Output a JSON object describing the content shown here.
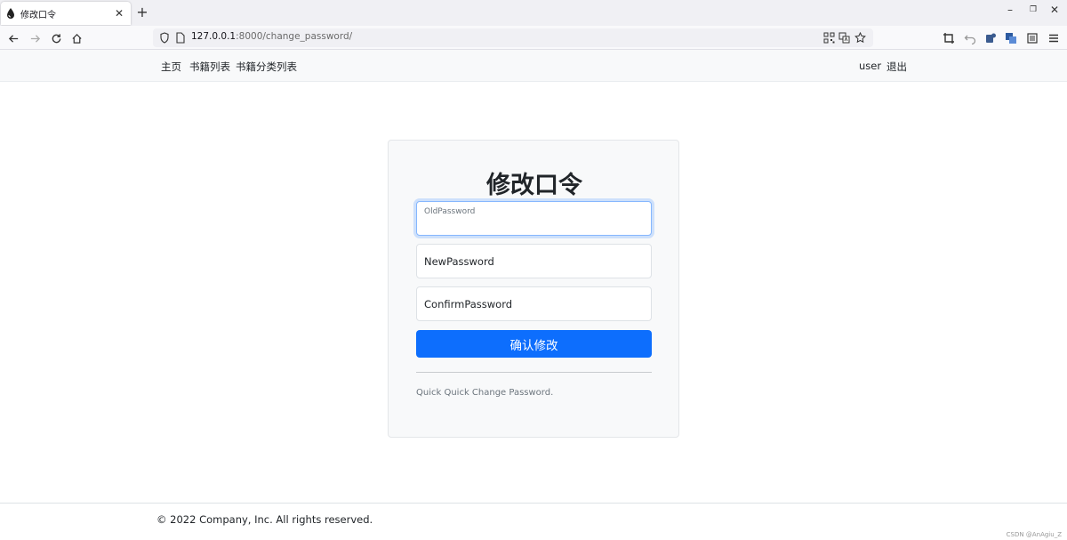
{
  "browser": {
    "tab_title": "修改口令",
    "new_tab": "+",
    "tab_close": "✕",
    "window_controls": {
      "minimize": "–",
      "restore": "❐",
      "close": "✕"
    },
    "url_host": "127.0.0.1",
    "url_path": ":8000/change_password/"
  },
  "site_nav": {
    "home": "主页",
    "book_list": "书籍列表",
    "category_list": "书籍分类列表",
    "user": "user",
    "logout": "退出"
  },
  "form": {
    "title": "修改口令",
    "old_password_label": "OldPassword",
    "new_password_placeholder": "NewPassword",
    "confirm_password_placeholder": "ConfirmPassword",
    "submit_label": "确认修改",
    "note": "Quick Quick Change Password."
  },
  "footer": {
    "copyright": "© 2022 Company, Inc. All rights reserved.",
    "watermark": "CSDN @AnAgiu_Z"
  },
  "colors": {
    "primary": "#0d6efd",
    "focus_ring": "#86b7fe"
  }
}
